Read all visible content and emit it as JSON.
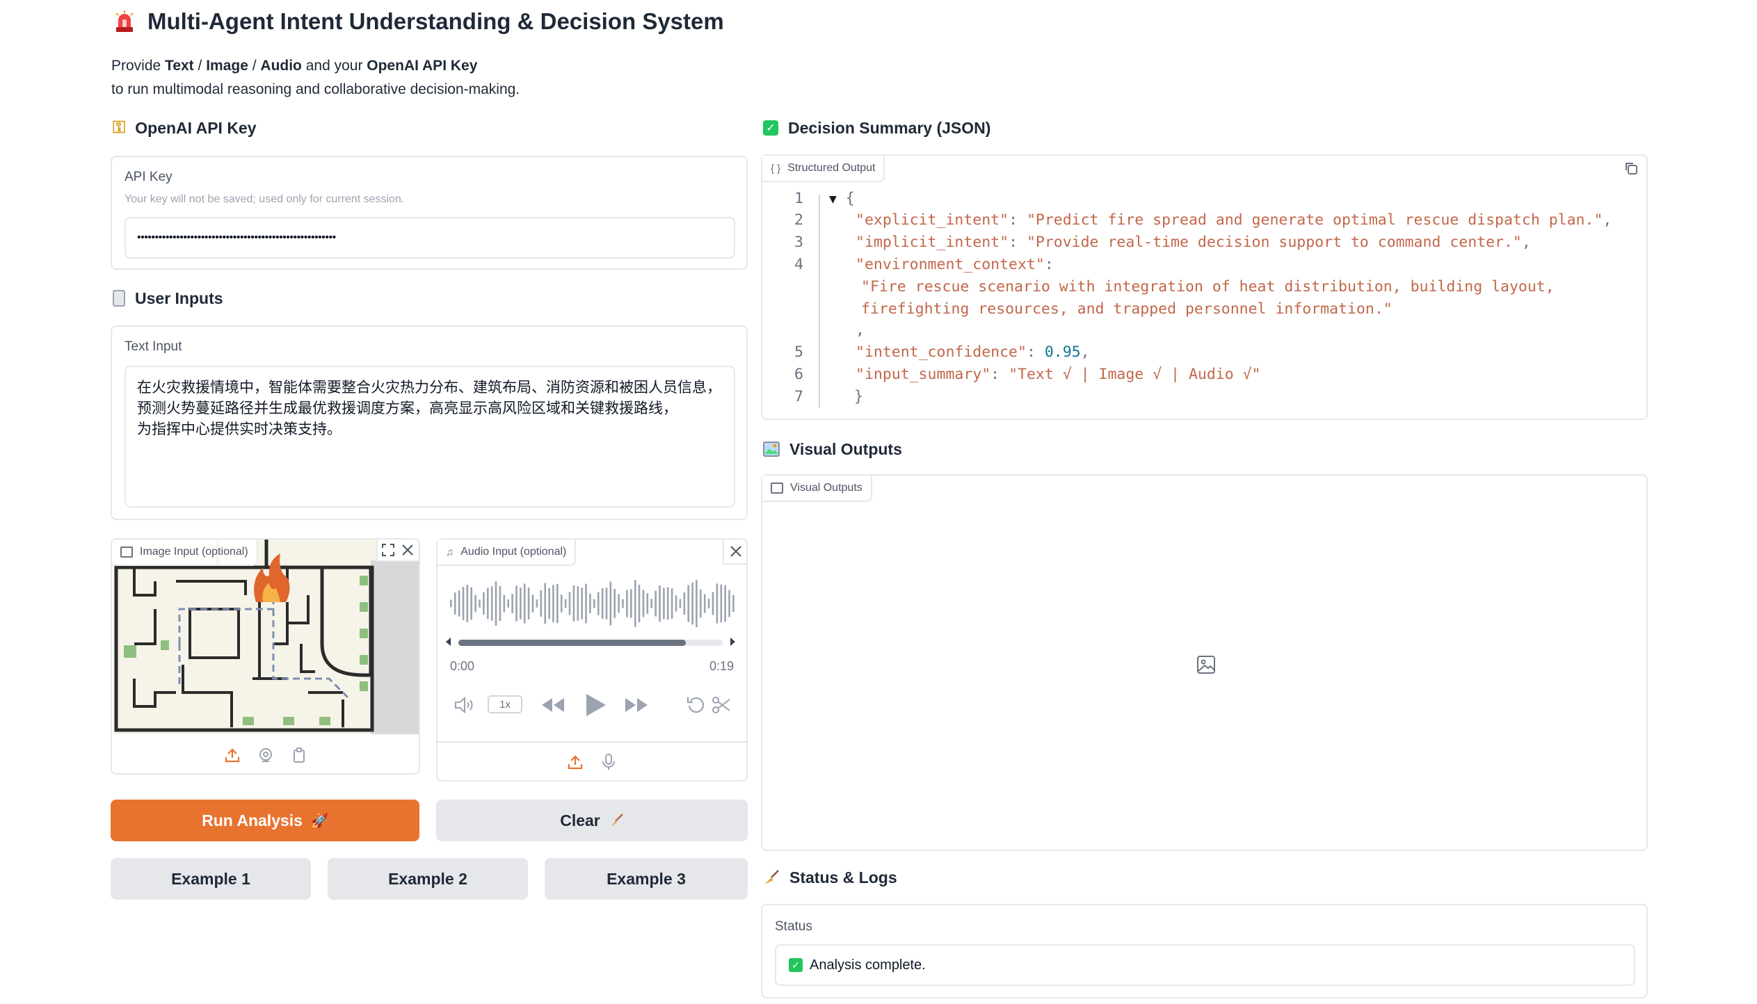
{
  "header": {
    "title": "Multi-Agent Intent Understanding & Decision System",
    "desc_1a": "Provide ",
    "desc_text": "Text",
    "desc_sep1": " / ",
    "desc_image": "Image",
    "desc_sep2": " / ",
    "desc_audio": "Audio",
    "desc_1b": " and your ",
    "desc_key": "OpenAI API Key",
    "desc_2": "to run multimodal reasoning and collaborative decision-making."
  },
  "api": {
    "section": "OpenAI API Key",
    "label": "API Key",
    "info": "Your key will not be saved; used only for current session.",
    "value": "••••••••••••••••••••••••••••••••••••••••••••••••••••••••"
  },
  "user_inputs": {
    "section": "User Inputs",
    "text_label": "Text Input",
    "text_value": "在火灾救援情境中，智能体需要整合火灾热力分布、建筑布局、消防资源和被困人员信息，\n预测火势蔓延路径并生成最优救援调度方案，高亮显示高风险区域和关键救援路线，\n为指挥中心提供实时决策支持。",
    "image_label": "Image Input (optional)",
    "audio_label": "Audio Input (optional)",
    "audio_time_start": "0:00",
    "audio_time_end": "0:19",
    "audio_speed": "1x",
    "audio_progress": 0.86
  },
  "actions": {
    "run": "Run Analysis",
    "clear": "Clear",
    "examples": [
      "Example 1",
      "Example 2",
      "Example 3"
    ]
  },
  "decision": {
    "section": "Decision Summary (JSON)",
    "tag": "Structured Output",
    "line_numbers": [
      "1",
      "2",
      "3",
      "4",
      "5",
      "6",
      "7"
    ],
    "open_brace": "{",
    "close_brace": "}",
    "explicit_key": "\"explicit_intent\"",
    "explicit_val": "\"Predict fire spread and generate optimal rescue dispatch plan.\"",
    "implicit_key": "\"implicit_intent\"",
    "implicit_val": "\"Provide real-time decision support to command center.\"",
    "env_key": "\"environment_context\"",
    "env_val_1": "\"Fire rescue scenario with integration of heat distribution, building layout,",
    "env_val_2": "firefighting resources, and trapped personnel information.\"",
    "conf_key": "\"intent_confidence\"",
    "conf_val": "0.95",
    "summary_key": "\"input_summary\"",
    "summary_val": "\"Text √ | Image √ | Audio √\""
  },
  "visual": {
    "section": "Visual Outputs",
    "tag": "Visual Outputs"
  },
  "status": {
    "section": "Status & Logs",
    "label": "Status",
    "value": "Analysis complete."
  },
  "colors": {
    "primary": "#e8732f",
    "code_string": "#c2674a",
    "code_number": "#0e7490"
  }
}
